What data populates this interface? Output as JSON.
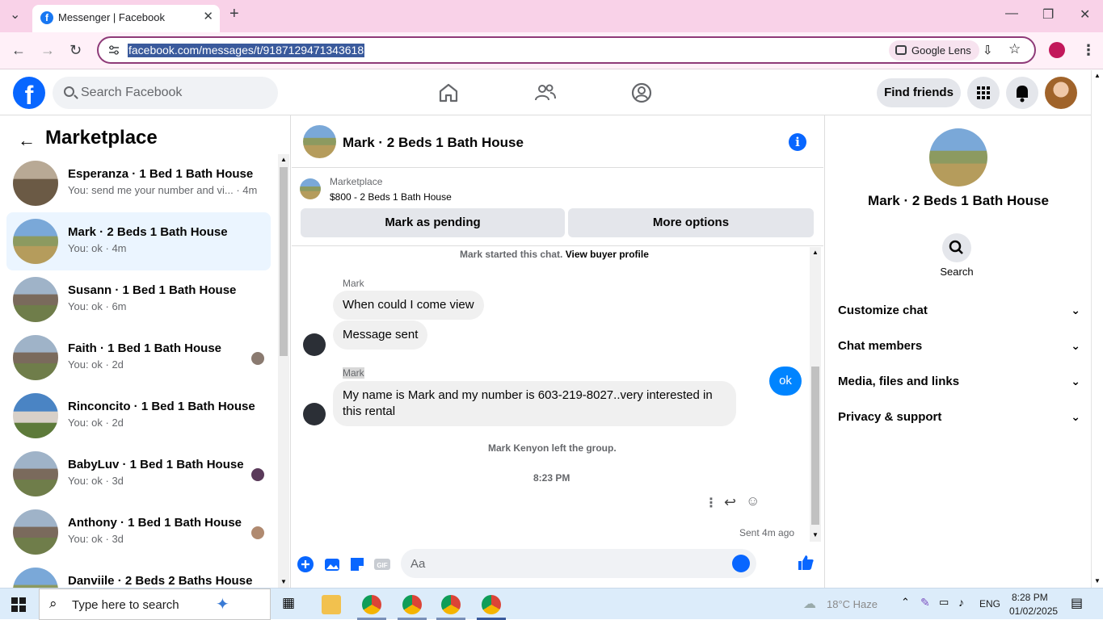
{
  "browser": {
    "tab_title": "Messenger | Facebook",
    "url": "facebook.com/messages/t/9187129471343618",
    "lens_label": "Google Lens"
  },
  "fb": {
    "search_placeholder": "Search Facebook",
    "find_friends": "Find friends"
  },
  "left": {
    "heading": "Marketplace",
    "conversations": [
      {
        "name": "Esperanza · 1 Bed 1 Bath House",
        "sub": "You: send me your number and vi... · 4m"
      },
      {
        "name": "Mark · 2 Beds 1 Bath House",
        "sub": "You: ok · 4m"
      },
      {
        "name": "Susann · 1 Bed 1 Bath House",
        "sub": "You: ok · 6m"
      },
      {
        "name": "Faith · 1 Bed 1 Bath House",
        "sub": "You: ok · 2d"
      },
      {
        "name": "Rinconcito · 1 Bed 1 Bath House",
        "sub": "You: ok · 2d"
      },
      {
        "name": "BabyLuv · 1 Bed 1 Bath House",
        "sub": "You: ok · 3d"
      },
      {
        "name": "Anthony · 1 Bed 1 Bath House",
        "sub": "You: ok · 3d"
      },
      {
        "name": "Danviile · 2 Beds 2 Baths House",
        "sub": ""
      }
    ]
  },
  "chat": {
    "title": "Mark · 2 Beds 1 Bath House",
    "marketplace_label": "Marketplace",
    "listing": "$800 - 2 Beds 1 Bath House",
    "mark_pending": "Mark as pending",
    "more_options": "More options",
    "started": "Mark started this chat.",
    "view_profile": "View buyer profile",
    "sender1": "Mark",
    "msg1": "When could I come view",
    "msg2": "Message sent",
    "sender2": "Mark",
    "msg3": "My name is Mark and my number is 603-219-8027..very interested in this rental",
    "left_group": "Mark Kenyon left the group.",
    "time": "8:23 PM",
    "my_msg": "ok",
    "sent": "Sent 4m ago",
    "composer_placeholder": "Aa"
  },
  "right": {
    "name": "Mark · 2 Beds 1 Bath House",
    "search_label": "Search",
    "sections": [
      "Customize chat",
      "Chat members",
      "Media, files and links",
      "Privacy & support"
    ]
  },
  "taskbar": {
    "search_placeholder": "Type here to search",
    "weather": "18°C  Haze",
    "lang": "ENG",
    "clock_time": "8:28 PM",
    "clock_date": "01/02/2025"
  }
}
